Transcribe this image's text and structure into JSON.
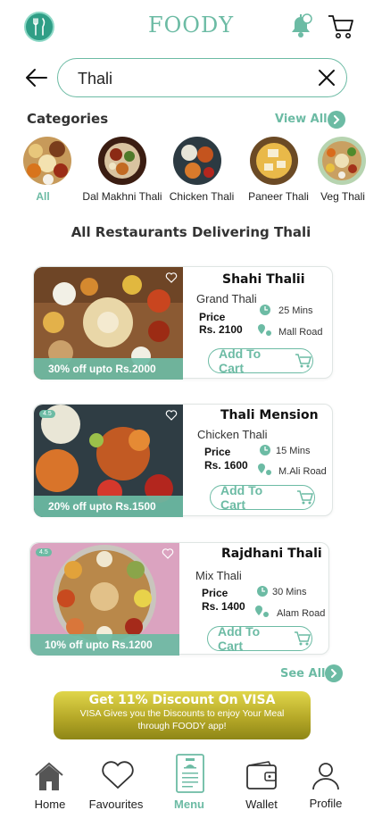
{
  "header": {
    "brand": "FOODY"
  },
  "search": {
    "value": "Thali",
    "placeholder": ""
  },
  "categories": {
    "title": "Categories",
    "view_all": "View All",
    "items": [
      {
        "label": "All",
        "active": true
      },
      {
        "label": "Dal Makhni Thali",
        "active": false
      },
      {
        "label": "Chicken Thali",
        "active": false
      },
      {
        "label": "Paneer Thali",
        "active": false
      },
      {
        "label": "Veg Thali",
        "active": false
      }
    ]
  },
  "restaurants": {
    "title": "All Restaurants Delivering Thali",
    "see_all": "See All",
    "add_to_cart": "Add To Cart",
    "price_label": "Price",
    "items": [
      {
        "name": "Shahi Thalii",
        "dish": "Grand Thali",
        "price": "Rs. 2100",
        "time": "25 Mins",
        "location": "Mall Road",
        "offer": "30% off upto Rs.2000",
        "rating": ""
      },
      {
        "name": "Thali Mension",
        "dish": "Chicken Thali",
        "price": "Rs. 1600",
        "time": "15 Mins",
        "location": "M.Ali Road",
        "offer": "20% off upto Rs.1500",
        "rating": "4.5"
      },
      {
        "name": "Rajdhani Thali",
        "dish": "Mix Thali",
        "price": "Rs. 1400",
        "time": "30 Mins",
        "location": "Alam Road",
        "offer": "10% off upto Rs.1200",
        "rating": "4.5"
      }
    ]
  },
  "banner": {
    "title": "Get 11% Discount On VISA",
    "subtitle": "VISA Gives you the Discounts to enjoy Your Meal through FOODY app!"
  },
  "nav": {
    "items": [
      {
        "label": "Home",
        "icon": "home-icon"
      },
      {
        "label": "Favourites",
        "icon": "heart-icon"
      },
      {
        "label": "Menu",
        "icon": "menu-icon",
        "active": true
      },
      {
        "label": "Wallet",
        "icon": "wallet-icon"
      },
      {
        "label": "Profile",
        "icon": "profile-icon"
      }
    ]
  },
  "colors": {
    "accent": "#6cbba4",
    "banner_gold": "#b6a928",
    "logo": "#2f9e86"
  }
}
